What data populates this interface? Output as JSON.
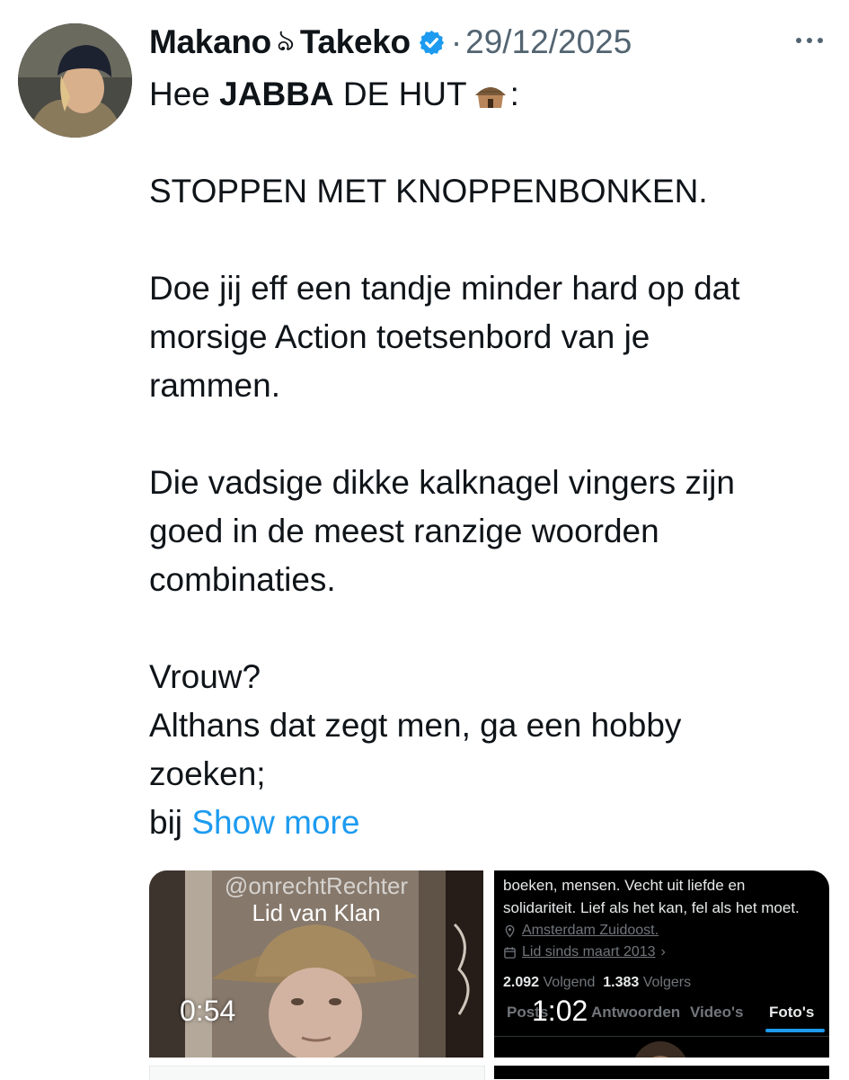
{
  "tweet": {
    "author_name": "Makano",
    "author_glyph": "ঌ",
    "author_name_2": "Takeko",
    "separator": "·",
    "date": "29/12/2025",
    "greeting_plain": "Hee ",
    "greeting_bold": "JABBA",
    "greeting_rest": " DE HUT",
    "greeting_end": ":",
    "line_stop": "STOPPEN MET KNOPPENBONKEN.",
    "para2_l1": "Doe jij eff een tandje minder hard op dat",
    "para2_l2": "morsige Action toetsenbord van je",
    "para2_l3": "rammen.",
    "para3_l1": "Die vadsige dikke kalknagel vingers zijn",
    "para3_l2": "goed in de meest ranzige woorden",
    "para3_l3": "combinaties.",
    "para4_l1": "Vrouw?",
    "para4_l2": "Althans dat zegt men, ga een hobby",
    "para4_l3": "zoeken;",
    "last_word": "bij ",
    "show_more": "Show more"
  },
  "media": {
    "left": {
      "handle": "@onrechtRechter",
      "caption": "Lid van Klan",
      "duration": "0:54"
    },
    "right": {
      "bio_l1": "boeken, mensen. Vecht uit liefde en",
      "bio_l2": "solidariteit. Lief als het kan, fel als het moet.",
      "location": "Amsterdam Zuidoost.",
      "member_since": "Lid sinds maart 2013",
      "following_count": "2.092",
      "following_label": "Volgend",
      "followers_count": "1.383",
      "followers_label": "Volgers",
      "tab_posts": "Posts",
      "tab_replies": "Antwoorden",
      "tab_videos": "Video's",
      "tab_photos": "Foto's",
      "duration": "1:02"
    }
  },
  "colors": {
    "link": "#1d9bf0",
    "verified": "#1d9bf0",
    "muted_text": "#536471"
  }
}
